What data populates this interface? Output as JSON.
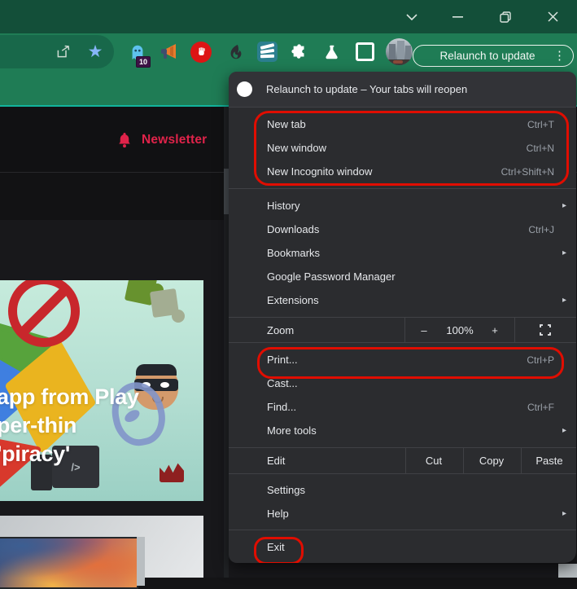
{
  "colors": {
    "titlebar_green": "#134f39",
    "toolbar_green": "#1f7c55",
    "menu_background": "#2b2c2f",
    "annotation_red": "#e00d00",
    "newsletter_red": "#e0234a",
    "page_topline_teal": "#12b49c"
  },
  "icons": {
    "star": "★",
    "kebab_dots": "⋮",
    "submenu_arrow": "▸"
  },
  "toolbar": {
    "relaunch_label": "Relaunch to update",
    "extension_badge": "10"
  },
  "menu": {
    "header": "Relaunch to update – Your tabs will reopen",
    "items": {
      "new_tab": {
        "label": "New tab",
        "shortcut": "Ctrl+T"
      },
      "new_window": {
        "label": "New window",
        "shortcut": "Ctrl+N"
      },
      "new_incognito": {
        "label": "New Incognito window",
        "shortcut": "Ctrl+Shift+N"
      },
      "history": {
        "label": "History"
      },
      "downloads": {
        "label": "Downloads",
        "shortcut": "Ctrl+J"
      },
      "bookmarks": {
        "label": "Bookmarks"
      },
      "password_manager": {
        "label": "Google Password Manager"
      },
      "extensions": {
        "label": "Extensions"
      },
      "zoom": {
        "label": "Zoom",
        "minus": "–",
        "value": "100%",
        "plus": "+"
      },
      "print": {
        "label": "Print...",
        "shortcut": "Ctrl+P"
      },
      "cast": {
        "label": "Cast..."
      },
      "find": {
        "label": "Find...",
        "shortcut": "Ctrl+F"
      },
      "more_tools": {
        "label": "More tools"
      },
      "edit": {
        "label": "Edit",
        "cut": "Cut",
        "copy": "Copy",
        "paste": "Paste"
      },
      "settings": {
        "label": "Settings"
      },
      "help": {
        "label": "Help"
      },
      "exit": {
        "label": "Exit"
      }
    }
  },
  "page": {
    "newsletter_label": "Newsletter",
    "headline": {
      "line1": "app from Play",
      "line2": "per-thin",
      "line3": "'piracy'"
    },
    "laptop_glyph": "/>"
  }
}
